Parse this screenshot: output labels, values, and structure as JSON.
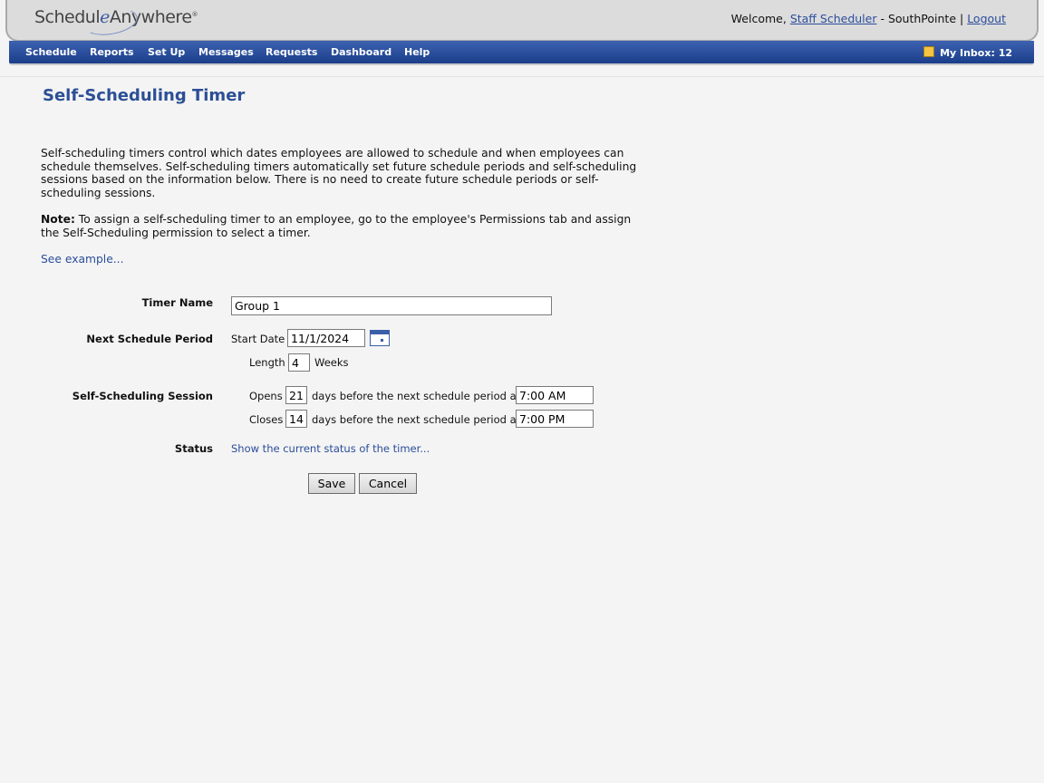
{
  "header": {
    "logo_part1": "Schedul",
    "logo_e": "e",
    "logo_part2": "Anywhere",
    "logo_reg": "®",
    "welcome_prefix": "Welcome,",
    "user_link": "Staff Scheduler",
    "org_text": "- SouthPointe |",
    "logout": "Logout"
  },
  "nav": {
    "items": [
      "Schedule",
      "Reports",
      "Set Up",
      "Messages",
      "Requests",
      "Dashboard",
      "Help"
    ],
    "inbox": "My Inbox: 12"
  },
  "page": {
    "title": "Self-Scheduling Timer",
    "intro": "Self-scheduling timers control which dates employees are allowed to schedule and when employees can schedule themselves. Self-scheduling timers automatically set future schedule periods and self-scheduling sessions based on the information below. There is no need to create future schedule periods or self-scheduling sessions.",
    "note_label": "Note:",
    "note_text": " To assign a self-scheduling timer to an employee, go to the employee's Permissions tab and assign the Self-Scheduling permission to select a timer.",
    "see_example": "See example..."
  },
  "form": {
    "timer_name_label": "Timer Name",
    "timer_name_value": "Group 1",
    "next_period_label": "Next Schedule Period",
    "start_date_label": "Start Date",
    "start_date_value": "11/1/2024",
    "length_label": "Length",
    "length_value": "4",
    "weeks_label": "Weeks",
    "session_label": "Self-Scheduling Session",
    "opens_label": "Opens",
    "opens_days": "21",
    "opens_mid": "days before the next schedule period at",
    "opens_time": "7:00 AM",
    "closes_label": "Closes",
    "closes_days": "14",
    "closes_mid": "days before the next schedule period at",
    "closes_time": "7:00 PM",
    "status_label": "Status",
    "status_link": "Show the current status of the timer...",
    "save": "Save",
    "cancel": "Cancel"
  }
}
